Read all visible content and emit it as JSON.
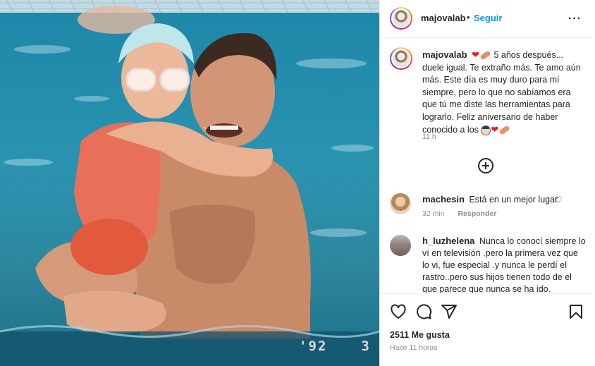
{
  "photo": {
    "stamp_year": "'92",
    "stamp_num": "3"
  },
  "post": {
    "username": "majovalab",
    "separator": "•",
    "follow_label": "Seguir",
    "more_label": "···",
    "caption": {
      "username": "majovalab",
      "text_part1": "5 años después... duele igual. Te extraño más. Te amo aún más. Este día es muy duro para mí siempre, pero lo que no sabíamos era que tú me diste las herramientas para lograrlo. Feliz aniversario de haber conocido a los",
      "time": "11 h"
    },
    "comments": [
      {
        "username": "machesin",
        "text": "Está en un mejor lugar",
        "time": "32 min",
        "reply_label": "Responder"
      },
      {
        "username": "h_luzhelena",
        "text": "Nunca lo conocí siempre lo ví en televisión .pero la primera vez que lo vi, fue especial .y nunca le perdí el rastro..pero sus hijos tienen todo de el que parece que nunca se ha ido."
      }
    ],
    "likes": "2511 Me gusta",
    "posted": "Hace 11 horas"
  },
  "colors": {
    "accent": "#0095f6",
    "heart": "#ed1c24",
    "muted": "#8e8e8e"
  },
  "icons": [
    "heart-icon",
    "comment-icon",
    "share-icon",
    "bookmark-icon",
    "plus-circle-icon",
    "more-icon"
  ]
}
